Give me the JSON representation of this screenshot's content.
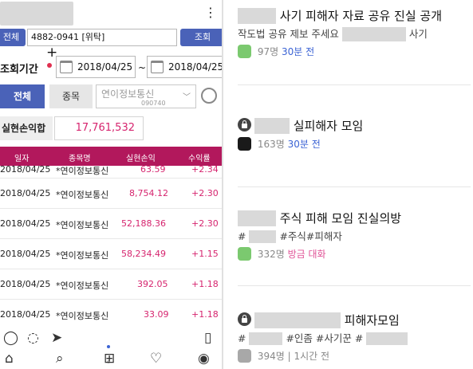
{
  "left_screen": {
    "account": {
      "left_button": "전체",
      "number": "4882-0941 [위탁]",
      "right_button": "조회"
    },
    "period": {
      "label": "조회기간",
      "cursor_symbol": "+",
      "from": "2018/04/25",
      "separator": "~",
      "to": "2018/04/25"
    },
    "filter": {
      "tab_all": "전체",
      "tab_stock": "종목",
      "stock_name": "연이정보통신",
      "stock_code": "090740"
    },
    "realized_profit": {
      "label": "실현손익합",
      "value": "17,761,532"
    },
    "table": {
      "headers": [
        "일자",
        "종목명",
        "실현손익",
        "수익률"
      ],
      "rows": [
        [
          "2018/04/25",
          "*연이정보통신",
          "63.59",
          "+2.34"
        ],
        [
          "2018/04/25",
          "*연이정보통신",
          "8,754.12",
          "+2.30"
        ],
        [
          "2018/04/25",
          "*연이정보통신",
          "52,188.36",
          "+2.30"
        ],
        [
          "2018/04/25",
          "*연이정보통신",
          "58,234.49",
          "+1.15"
        ],
        [
          "2018/04/25",
          "*연이정보통신",
          "392.05",
          "+1.18"
        ],
        [
          "2018/04/25",
          "*연이정보통신",
          "33.09",
          "+1.18"
        ]
      ]
    },
    "nav_icons": [
      "comment-icon",
      "send-icon",
      "bookmark-icon",
      "home-icon",
      "search-icon",
      "add-icon",
      "heart-icon",
      "profile-icon"
    ]
  },
  "rooms": [
    {
      "title": "사기 피해자 자료 공유 진실 공개",
      "desc_prefix": "작도법 공유 제보 주세요",
      "desc_suffix": "사기",
      "count": "97명",
      "time": "30분 전",
      "avatar_color": "#7bc96f"
    },
    {
      "title": "실피해자 모임",
      "count": "163명",
      "time": "30분 전",
      "avatar_color": "#1a1a1a"
    },
    {
      "title": "주식 피해 모임 진실의방",
      "tags_a": "#",
      "tags_b": "#주식#피해자",
      "count": "332명",
      "time": "방금 대화",
      "avatar_color": "#7bc96f"
    },
    {
      "title": "피해자모임",
      "tags_a": "#",
      "tags_b": "#인좀 #사기꾼 #",
      "count": "394명",
      "separator": "|",
      "time": "1시간 전",
      "avatar_color": "#a8a8a8"
    }
  ],
  "colors": {
    "accent_blue": "#3b63d4",
    "pink_recent": "#e05296",
    "table_header": "#b2185c",
    "profit_red": "#d6246e",
    "button_blue": "#4a62b8"
  }
}
